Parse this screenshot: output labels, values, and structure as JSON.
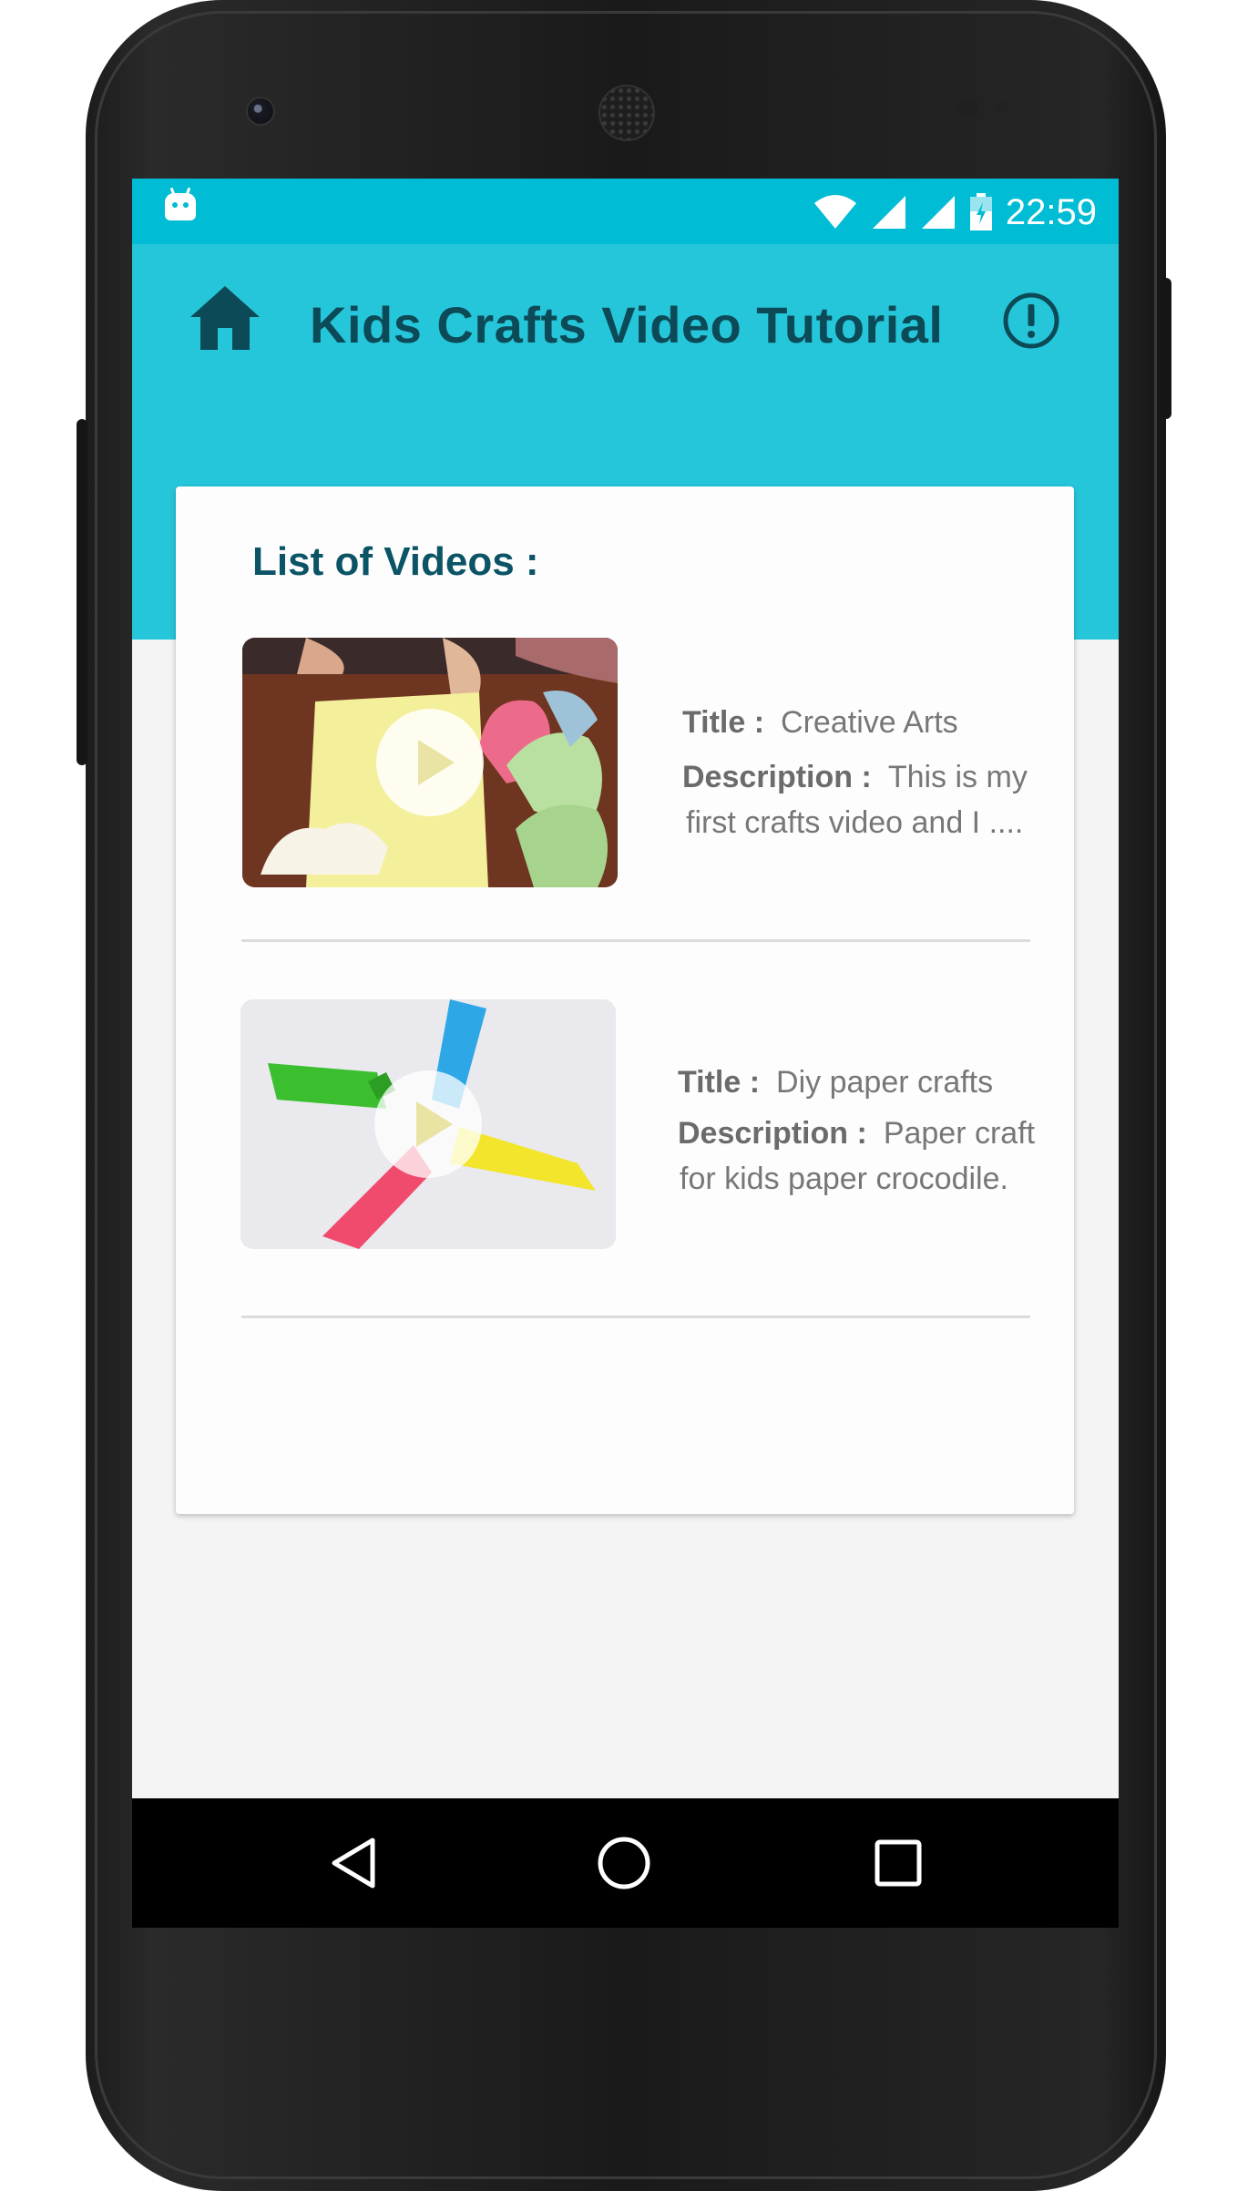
{
  "status_bar": {
    "time": "22:59",
    "icons": [
      "android-icon",
      "wifi-icon",
      "signal-icon",
      "signal-icon",
      "battery-icon"
    ],
    "color": "#00bcd4"
  },
  "app_bar": {
    "title": "Kids Crafts Video Tutorial",
    "left_icon": "home-icon",
    "right_icon": "info-icon",
    "color": "#26c6da",
    "title_color": "#0c4a57"
  },
  "card": {
    "heading": "List of Videos :",
    "videos": [
      {
        "thumbnail": "crafts-hands-thumbnail",
        "title_label": "Title :",
        "title": "Creative Arts",
        "description_label": "Description :",
        "description_line1": "This is my",
        "description_line2": "first crafts video and I ...."
      },
      {
        "thumbnail": "paper-crocodiles-thumbnail",
        "title_label": "Title :",
        "title": "Diy paper crafts",
        "description_label": "Description :",
        "description_line1": "Paper craft",
        "description_line2": "for kids paper crocodile."
      }
    ]
  },
  "nav_bar": {
    "buttons": [
      "back-icon",
      "home-circle-icon",
      "recents-icon"
    ]
  }
}
